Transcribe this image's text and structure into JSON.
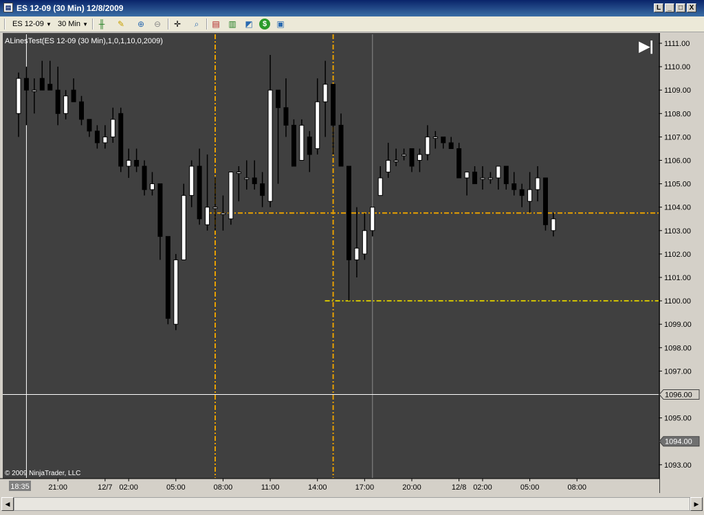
{
  "window": {
    "title": "ES 12-09 (30 Min)  12/8/2009",
    "app_icon": "chart-icon",
    "buttons": [
      "L",
      "_",
      "□",
      "X"
    ]
  },
  "toolbar": {
    "instrument": "ES 12-09",
    "interval": "30 Min",
    "icons": [
      "candlestick-icon",
      "pencil-draw-icon",
      "zoom-in-icon",
      "zoom-out-icon",
      "crosshair-icon",
      "search-icon",
      "strategy-icon",
      "indicators-icon",
      "chart-properties-icon",
      "dollar-icon",
      "data-box-icon"
    ]
  },
  "chart": {
    "indicator_label": "ALinesTest(ES 12-09 (30 Min),1,0,1,10,0,2009)",
    "copyright": "© 2009 NinjaTrader, LLC",
    "go_to_latest": "▶|",
    "colors": {
      "background": "#404040",
      "up_fill": "#ffffff",
      "down_fill": "#000000",
      "wick": "#000000",
      "orange_line": "#e8a000",
      "yellow_line": "#d8c800",
      "crosshair": "#ffffff"
    }
  },
  "chart_data": {
    "type": "candlestick",
    "y_ticks": [
      "1111.00",
      "1110.00",
      "1109.00",
      "1108.00",
      "1107.00",
      "1106.00",
      "1105.00",
      "1104.00",
      "1103.00",
      "1102.00",
      "1101.00",
      "1100.00",
      "1099.00",
      "1098.00",
      "1097.00",
      "1096.00",
      "1095.00",
      "1094.00",
      "1093.00"
    ],
    "y_tick_values": [
      1111,
      1110,
      1109,
      1108,
      1107,
      1106,
      1105,
      1104,
      1103,
      1102,
      1101,
      1100,
      1099,
      1098,
      1097,
      1096,
      1095,
      1094,
      1093
    ],
    "x_labels": [
      "18:35",
      "21:00",
      "12/7",
      "02:00",
      "05:00",
      "08:00",
      "11:00",
      "14:00",
      "17:00",
      "20:00",
      "12/8",
      "02:00",
      "05:00",
      "08:00"
    ],
    "x_label_bar_index": [
      0,
      5,
      11,
      14,
      20,
      26,
      32,
      38,
      44,
      50,
      56,
      59,
      65,
      71
    ],
    "crosshair_price_label": "1096.00",
    "crosshair_price": 1096.0,
    "price_marker_label": "1094.00",
    "price_marker": 1094.0,
    "horizontal_lines": [
      {
        "color": "orange",
        "price": 1103.75,
        "from_bar": 25,
        "dash": "dash-dot"
      },
      {
        "color": "yellow",
        "price": 1100.0,
        "from_bar": 40,
        "dash": "dash-dot"
      }
    ],
    "vertical_lines": [
      {
        "color": "orange",
        "bar": 25
      },
      {
        "color": "orange",
        "bar": 40
      }
    ],
    "gray_vertical_bar": 45,
    "crosshair_bar": 1,
    "candles": [
      {
        "o": 1108.0,
        "h": 1109.75,
        "l": 1107.0,
        "c": 1109.5
      },
      {
        "o": 1109.5,
        "h": 1110.0,
        "l": 1107.5,
        "c": 1109.0
      },
      {
        "o": 1109.0,
        "h": 1109.5,
        "l": 1108.0,
        "c": 1109.0
      },
      {
        "o": 1109.5,
        "h": 1110.25,
        "l": 1109.0,
        "c": 1109.0
      },
      {
        "o": 1109.25,
        "h": 1110.25,
        "l": 1109.0,
        "c": 1109.0
      },
      {
        "o": 1109.0,
        "h": 1110.0,
        "l": 1107.5,
        "c": 1108.0
      },
      {
        "o": 1108.0,
        "h": 1109.0,
        "l": 1107.75,
        "c": 1108.75
      },
      {
        "o": 1109.0,
        "h": 1109.5,
        "l": 1108.5,
        "c": 1108.5
      },
      {
        "o": 1108.5,
        "h": 1108.75,
        "l": 1107.5,
        "c": 1107.75
      },
      {
        "o": 1107.75,
        "h": 1107.75,
        "l": 1107.0,
        "c": 1107.25
      },
      {
        "o": 1107.25,
        "h": 1107.5,
        "l": 1106.5,
        "c": 1106.75
      },
      {
        "o": 1106.75,
        "h": 1107.5,
        "l": 1106.5,
        "c": 1107.0
      },
      {
        "o": 1107.0,
        "h": 1108.25,
        "l": 1106.75,
        "c": 1107.75
      },
      {
        "o": 1108.0,
        "h": 1108.25,
        "l": 1105.5,
        "c": 1105.75
      },
      {
        "o": 1105.75,
        "h": 1106.5,
        "l": 1105.25,
        "c": 1106.0
      },
      {
        "o": 1106.0,
        "h": 1106.5,
        "l": 1105.5,
        "c": 1105.75
      },
      {
        "o": 1105.75,
        "h": 1106.0,
        "l": 1104.5,
        "c": 1104.75
      },
      {
        "o": 1104.75,
        "h": 1105.5,
        "l": 1104.5,
        "c": 1105.0
      },
      {
        "o": 1105.0,
        "h": 1105.0,
        "l": 1101.75,
        "c": 1102.75
      },
      {
        "o": 1102.75,
        "h": 1102.75,
        "l": 1099.0,
        "c": 1099.25
      },
      {
        "o": 1099.0,
        "h": 1102.0,
        "l": 1098.75,
        "c": 1101.75
      },
      {
        "o": 1101.75,
        "h": 1105.0,
        "l": 1101.75,
        "c": 1104.5
      },
      {
        "o": 1104.5,
        "h": 1106.0,
        "l": 1104.0,
        "c": 1105.75
      },
      {
        "o": 1105.75,
        "h": 1106.5,
        "l": 1103.25,
        "c": 1103.5
      },
      {
        "o": 1103.25,
        "h": 1106.25,
        "l": 1103.0,
        "c": 1104.0
      },
      {
        "o": 1104.0,
        "h": 1105.25,
        "l": 1103.0,
        "c": 1104.0
      },
      {
        "o": 1103.75,
        "h": 1104.5,
        "l": 1103.0,
        "c": 1103.75
      },
      {
        "o": 1103.5,
        "h": 1105.5,
        "l": 1103.25,
        "c": 1105.5
      },
      {
        "o": 1105.5,
        "h": 1105.75,
        "l": 1104.25,
        "c": 1105.5
      },
      {
        "o": 1105.25,
        "h": 1106.0,
        "l": 1104.75,
        "c": 1105.25
      },
      {
        "o": 1105.25,
        "h": 1106.0,
        "l": 1104.75,
        "c": 1105.0
      },
      {
        "o": 1105.0,
        "h": 1105.5,
        "l": 1104.0,
        "c": 1104.5
      },
      {
        "o": 1104.25,
        "h": 1110.5,
        "l": 1104.0,
        "c": 1109.0
      },
      {
        "o": 1109.0,
        "h": 1109.0,
        "l": 1105.0,
        "c": 1108.25
      },
      {
        "o": 1108.25,
        "h": 1109.5,
        "l": 1107.0,
        "c": 1107.5
      },
      {
        "o": 1107.5,
        "h": 1107.75,
        "l": 1105.75,
        "c": 1105.75
      },
      {
        "o": 1106.0,
        "h": 1107.75,
        "l": 1106.0,
        "c": 1107.5
      },
      {
        "o": 1107.0,
        "h": 1107.25,
        "l": 1105.5,
        "c": 1106.25
      },
      {
        "o": 1106.5,
        "h": 1109.5,
        "l": 1106.25,
        "c": 1108.5
      },
      {
        "o": 1108.5,
        "h": 1110.25,
        "l": 1107.0,
        "c": 1109.25
      },
      {
        "o": 1109.25,
        "h": 1109.25,
        "l": 1106.25,
        "c": 1107.5
      },
      {
        "o": 1107.5,
        "h": 1108.0,
        "l": 1105.75,
        "c": 1105.75
      },
      {
        "o": 1105.75,
        "h": 1105.75,
        "l": 1100.0,
        "c": 1101.75
      },
      {
        "o": 1101.75,
        "h": 1104.0,
        "l": 1101.0,
        "c": 1102.25
      },
      {
        "o": 1102.0,
        "h": 1103.75,
        "l": 1101.75,
        "c": 1103.0
      },
      {
        "o": 1103.0,
        "h": 1104.0,
        "l": 1102.75,
        "c": 1104.0
      },
      {
        "o": 1104.5,
        "h": 1105.75,
        "l": 1104.5,
        "c": 1105.25
      },
      {
        "o": 1105.5,
        "h": 1106.75,
        "l": 1105.25,
        "c": 1106.0
      },
      {
        "o": 1106.0,
        "h": 1106.5,
        "l": 1105.75,
        "c": 1106.0
      },
      {
        "o": 1106.25,
        "h": 1106.5,
        "l": 1106.0,
        "c": 1106.25
      },
      {
        "o": 1106.5,
        "h": 1106.5,
        "l": 1105.5,
        "c": 1105.75
      },
      {
        "o": 1106.0,
        "h": 1106.5,
        "l": 1105.5,
        "c": 1106.25
      },
      {
        "o": 1106.25,
        "h": 1107.5,
        "l": 1106.0,
        "c": 1107.0
      },
      {
        "o": 1107.0,
        "h": 1107.25,
        "l": 1106.5,
        "c": 1107.0
      },
      {
        "o": 1107.0,
        "h": 1107.0,
        "l": 1106.5,
        "c": 1106.75
      },
      {
        "o": 1106.75,
        "h": 1107.0,
        "l": 1106.5,
        "c": 1106.5
      },
      {
        "o": 1106.5,
        "h": 1106.75,
        "l": 1105.25,
        "c": 1105.25
      },
      {
        "o": 1105.25,
        "h": 1105.5,
        "l": 1104.5,
        "c": 1105.5
      },
      {
        "o": 1105.5,
        "h": 1105.75,
        "l": 1105.0,
        "c": 1105.0
      },
      {
        "o": 1105.25,
        "h": 1105.75,
        "l": 1104.75,
        "c": 1105.25
      },
      {
        "o": 1105.25,
        "h": 1105.5,
        "l": 1105.0,
        "c": 1105.25
      },
      {
        "o": 1105.25,
        "h": 1105.75,
        "l": 1104.75,
        "c": 1105.75
      },
      {
        "o": 1105.75,
        "h": 1105.75,
        "l": 1104.75,
        "c": 1105.0
      },
      {
        "o": 1105.0,
        "h": 1105.5,
        "l": 1104.5,
        "c": 1104.75
      },
      {
        "o": 1104.75,
        "h": 1105.0,
        "l": 1104.0,
        "c": 1104.5
      },
      {
        "o": 1104.25,
        "h": 1105.5,
        "l": 1103.75,
        "c": 1104.75
      },
      {
        "o": 1104.75,
        "h": 1105.75,
        "l": 1104.25,
        "c": 1105.25
      },
      {
        "o": 1105.25,
        "h": 1105.25,
        "l": 1103.0,
        "c": 1103.25
      },
      {
        "o": 1103.0,
        "h": 1103.75,
        "l": 1102.75,
        "c": 1103.5
      }
    ]
  }
}
